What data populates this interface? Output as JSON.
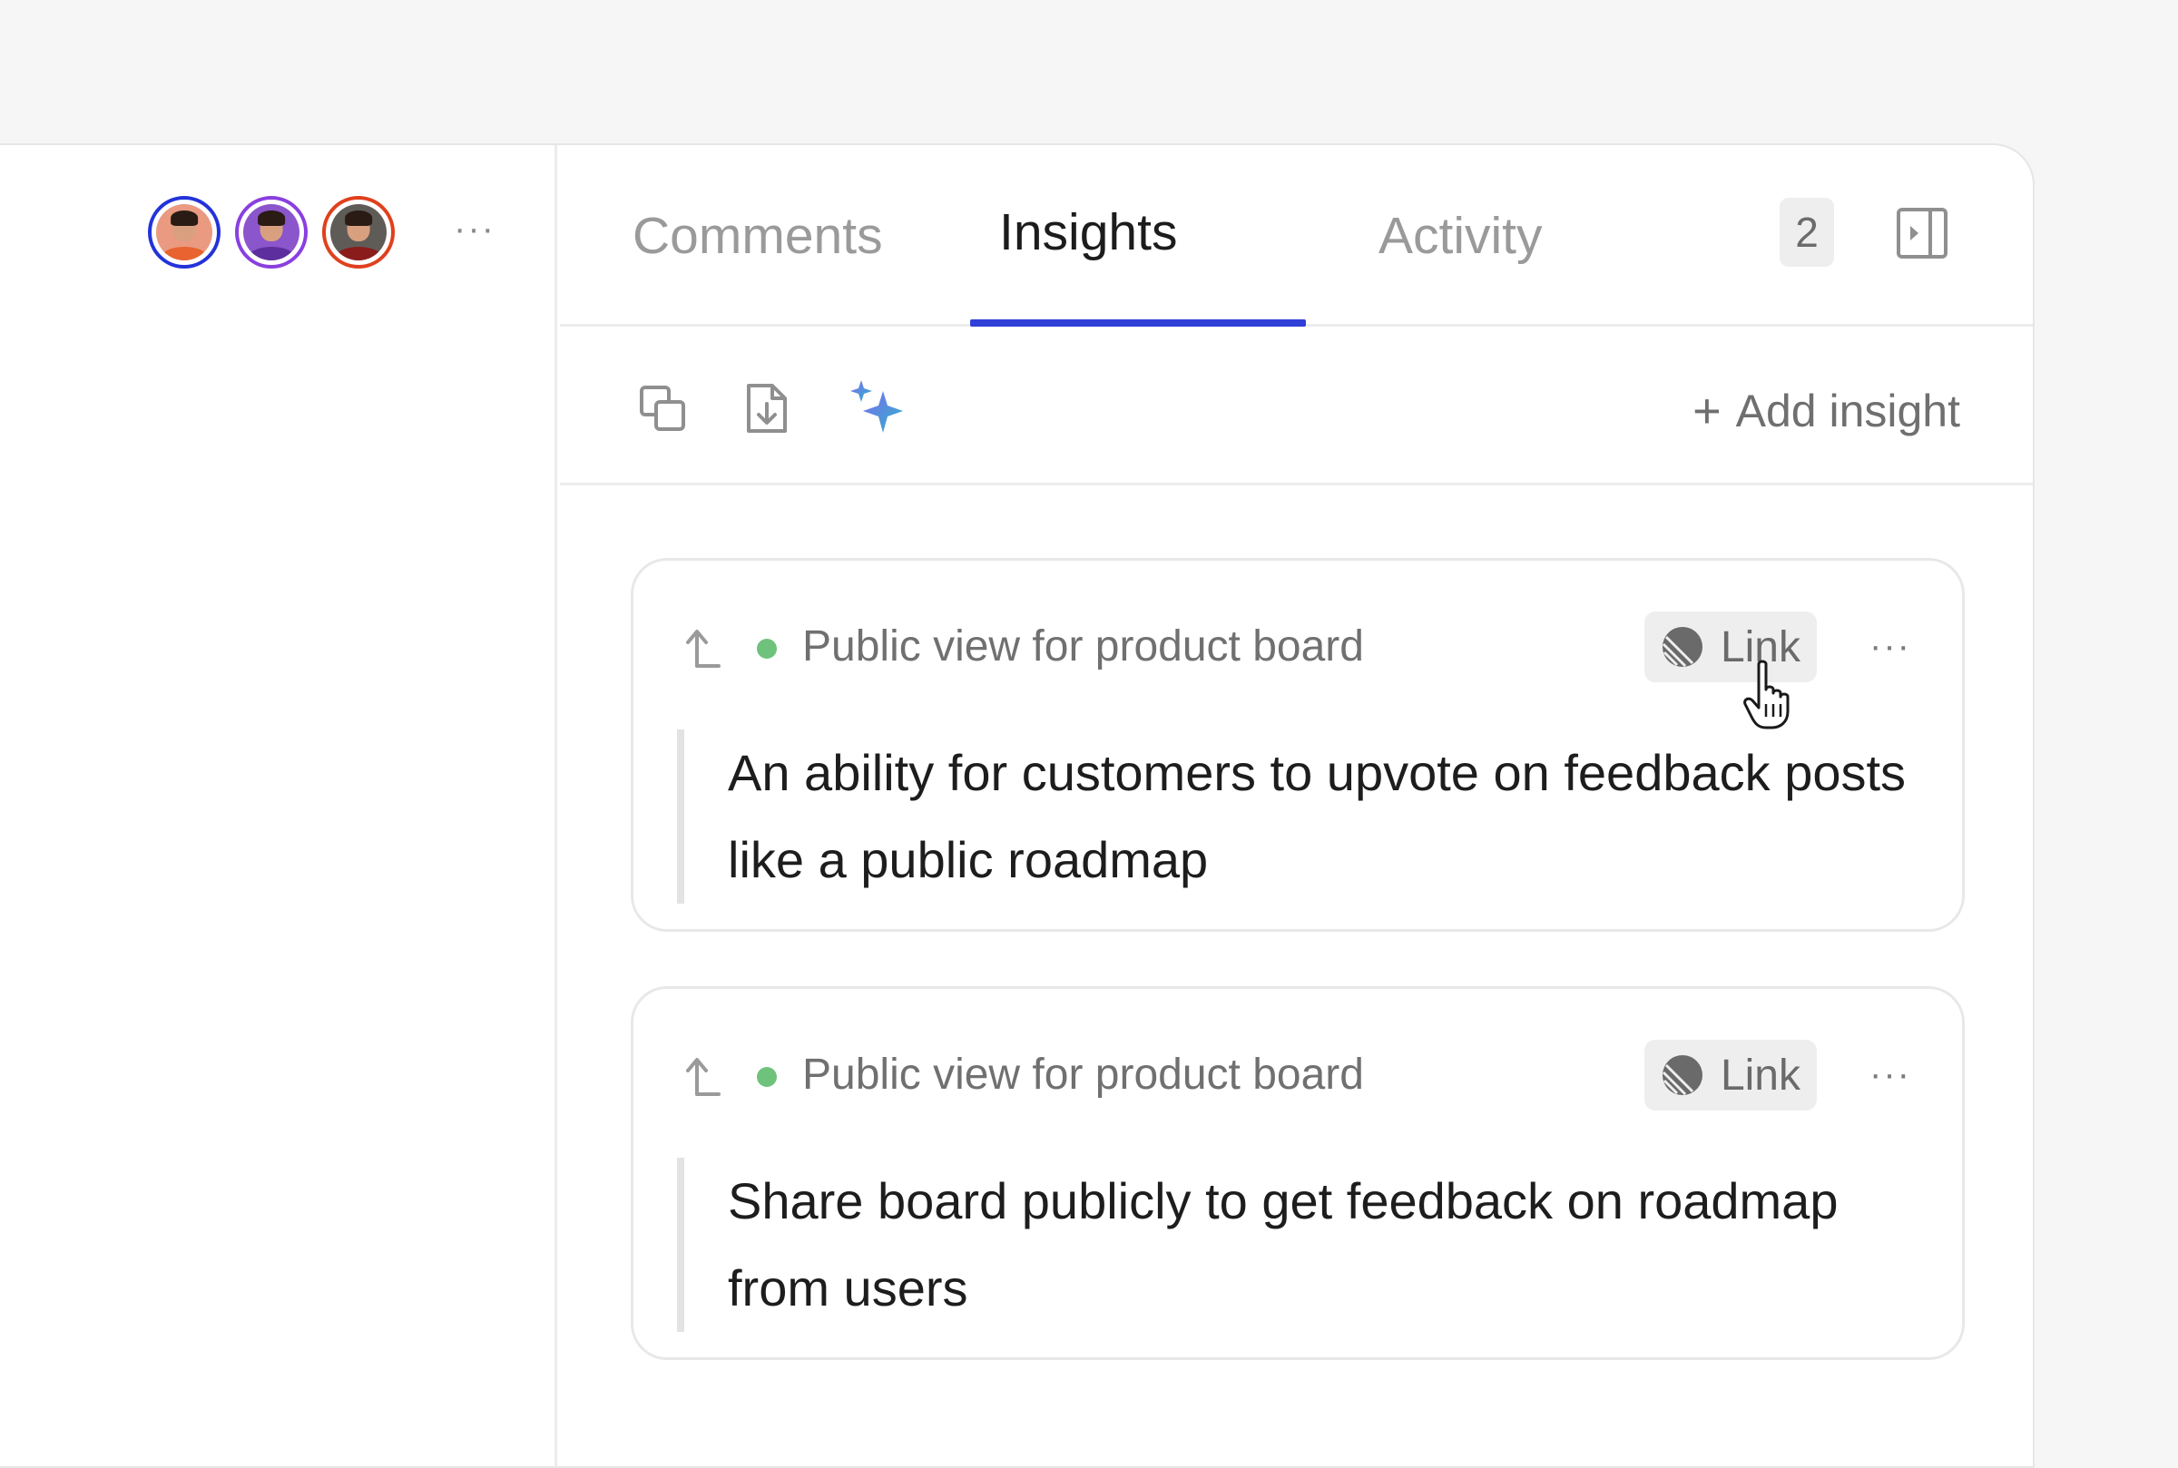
{
  "collaborators": {
    "avatars": [
      {
        "name": "collaborator-1",
        "ring_color": "#2333d9"
      },
      {
        "name": "collaborator-2",
        "ring_color": "#8a3fe0"
      },
      {
        "name": "collaborator-3",
        "ring_color": "#e0401e"
      }
    ],
    "more_label": "···"
  },
  "tabs": {
    "comments": "Comments",
    "insights": "Insights",
    "insights_count": "2",
    "activity": "Activity",
    "active": "insights",
    "accent_color": "#2f3fd8"
  },
  "toolbar": {
    "icons": [
      "copy-icon",
      "import-icon",
      "ai-sparkle-icon"
    ],
    "add_insight_plus": "+",
    "add_insight_label": "Add insight"
  },
  "insights": [
    {
      "source": "Public view for product board",
      "status_color": "#6fc27c",
      "link_label": "Link",
      "more_label": "···",
      "text": "An ability for customers to upvote on feedback posts like a public roadmap"
    },
    {
      "source": "Public view for product board",
      "status_color": "#6fc27c",
      "link_label": "Link",
      "more_label": "···",
      "text": "Share board publicly to get feedback on roadmap from users"
    }
  ]
}
